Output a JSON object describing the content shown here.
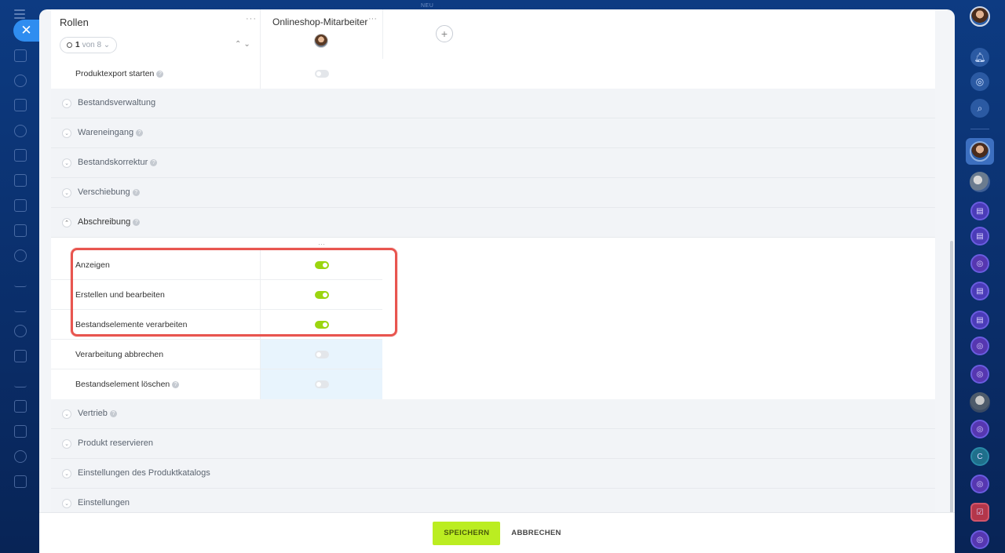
{
  "top_hint": "NEU",
  "roles_header": {
    "title": "Rollen",
    "menu": "···",
    "pager": {
      "current": "1",
      "rest": "von 8 ⌄"
    },
    "sort": "⌃⌄"
  },
  "columns": [
    {
      "title": "Onlineshop-Mitarbeiter",
      "menu": "···"
    }
  ],
  "add_column": "+",
  "top_permission": {
    "label": "Produktexport starten",
    "enabled": false
  },
  "sections_collapsed_top": [
    {
      "title": "Bestandsverwaltung",
      "help": false
    },
    {
      "title": "Wareneingang",
      "help": true
    },
    {
      "title": "Bestandskorrektur",
      "help": true
    },
    {
      "title": "Verschiebung",
      "help": true
    }
  ],
  "open_section": {
    "title": "Abschreibung",
    "help": true
  },
  "column_menu": "···",
  "permissions": [
    {
      "label": "Anzeigen",
      "enabled": true,
      "help": false
    },
    {
      "label": "Erstellen und bearbeiten",
      "enabled": true,
      "help": false
    },
    {
      "label": "Bestandselemente verarbeiten",
      "enabled": true,
      "help": false
    },
    {
      "label": "Verarbeitung abbrechen",
      "enabled": false,
      "help": false
    },
    {
      "label": "Bestandselement löschen",
      "enabled": false,
      "help": true
    }
  ],
  "sections_collapsed_bottom": [
    {
      "title": "Vertrieb",
      "help": true
    },
    {
      "title": "Produkt reservieren",
      "help": false
    },
    {
      "title": "Einstellungen des Produktkatalogs",
      "help": false
    },
    {
      "title": "Einstellungen",
      "help": false
    }
  ],
  "footer": {
    "save": "SPEICHERN",
    "cancel": "ABBRECHEN"
  },
  "colors": {
    "accent": "#bbed21",
    "toggle_on": "#9bd50f",
    "highlight": "#e8554f",
    "close_button": "#2f8df0"
  },
  "right_rail_chip_letter": "C"
}
